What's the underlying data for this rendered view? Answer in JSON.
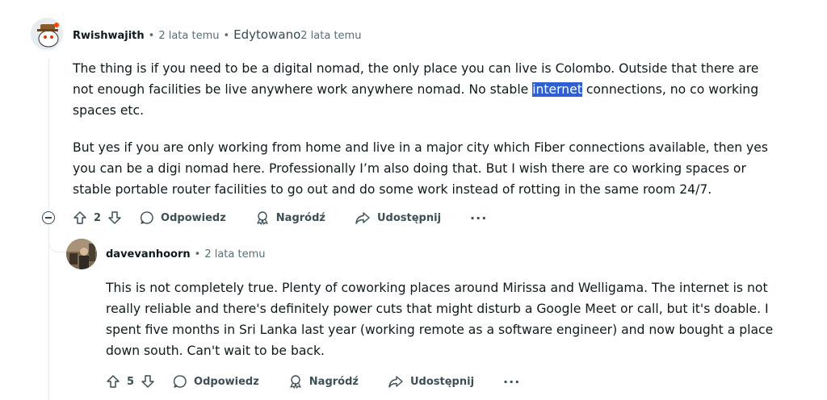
{
  "comments": [
    {
      "author": "Rwishwajith",
      "time": "2 lata temu",
      "edited_label": "Edytowano",
      "edited_time": "2 lata temu",
      "paragraphs": [
        {
          "pre": "The thing is if you need to be a digital nomad, the only place you can live is Colombo. Outside that there are not enough facilities be live anywhere work anywhere nomad. No stable ",
          "highlight": "internet",
          "post": " connections, no co working spaces etc."
        },
        {
          "text": "But yes if you are only working from home and live in a major city which Fiber connections available, then yes you can be a digi nomad here. Professionally I’m also doing that. But I wish there are co working spaces or stable portable router facilities to go out and do some work instead of rotting in the same room 24/7."
        }
      ],
      "score": "2",
      "actions": {
        "reply": "Odpowiedz",
        "award": "Nagródź",
        "share": "Udostępnij",
        "more": "···"
      }
    },
    {
      "author": "davevanhoorn",
      "time": "2 lata temu",
      "paragraphs": [
        {
          "text": "This is not completely true. Plenty of coworking places around Mirissa and Welligama. The internet is not really reliable and there's definitely power cuts that might disturb a Google Meet or call, but it's doable. I spent five months in Sri Lanka last year (working remote as a software engineer) and now bought a place down south. Can't wait to be back."
        }
      ],
      "score": "5",
      "actions": {
        "reply": "Odpowiedz",
        "award": "Nagródź",
        "share": "Udostępnij",
        "more": "···"
      }
    }
  ]
}
